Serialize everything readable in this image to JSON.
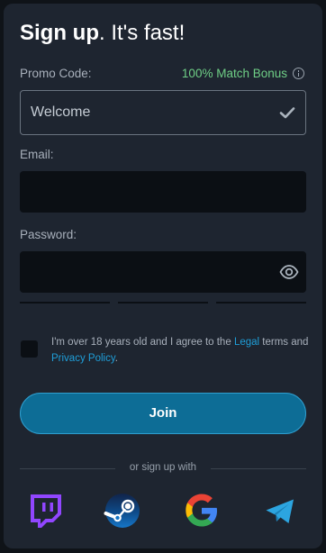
{
  "header": {
    "title_bold": "Sign up",
    "title_rest": ". It's fast!"
  },
  "promo": {
    "label": "Promo Code:",
    "bonus_text": "100% Match Bonus",
    "value": "Welcome",
    "check_icon": "check-icon",
    "info_icon": "info-icon"
  },
  "email": {
    "label": "Email:",
    "value": "",
    "placeholder": ""
  },
  "password": {
    "label": "Password:",
    "value": "",
    "placeholder": "",
    "toggle_icon": "eye-icon"
  },
  "terms": {
    "text_before": "I'm over 18 years old and I agree to the ",
    "legal_link": "Legal",
    "text_middle": " terms and ",
    "privacy_link": "Privacy Policy",
    "text_after": "."
  },
  "join_button": {
    "label": "Join"
  },
  "divider": {
    "text": "or sign up with"
  },
  "social": [
    {
      "name": "twitch-icon"
    },
    {
      "name": "steam-icon"
    },
    {
      "name": "google-icon"
    },
    {
      "name": "telegram-icon"
    }
  ],
  "colors": {
    "background": "#0f1318",
    "card": "#1e2530",
    "field_dark": "#0b0f14",
    "bonus_green": "#6fcf86",
    "link_blue": "#1f9ed8",
    "button_fill": "#0d6d96",
    "button_border": "#2f9fd0",
    "twitch_purple": "#9146ff",
    "telegram_blue": "#2ca5e0"
  }
}
